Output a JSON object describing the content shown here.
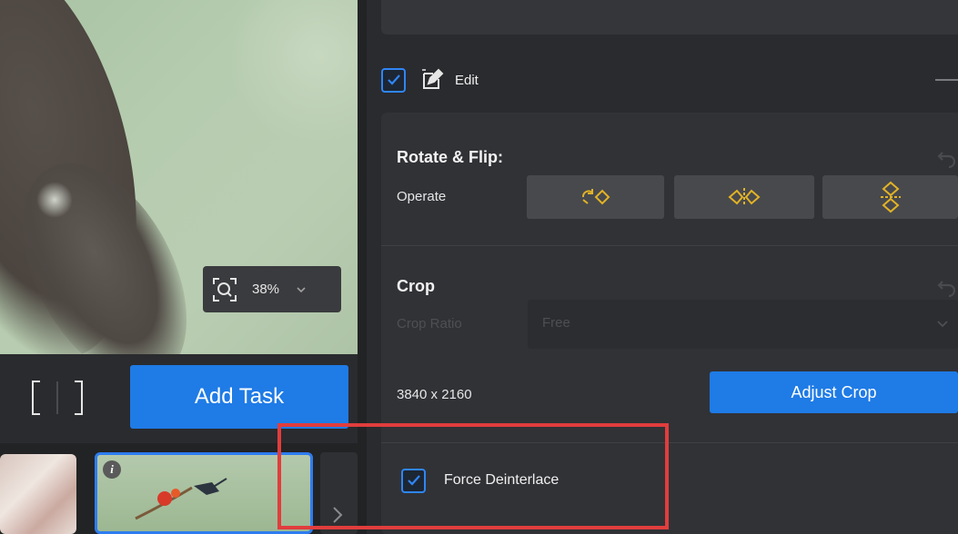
{
  "preview": {
    "zoom_value": "38%"
  },
  "bottom_bar": {
    "add_task_label": "Add Task"
  },
  "edit": {
    "label": "Edit",
    "checked": true
  },
  "rotate_flip": {
    "title": "Rotate & Flip:",
    "operate_label": "Operate",
    "buttons": [
      "rotate-icon",
      "flip-horizontal-icon",
      "flip-vertical-icon"
    ]
  },
  "crop": {
    "title": "Crop",
    "ratio_label": "Crop Ratio",
    "ratio_value": "Free",
    "resolution": "3840 x 2160",
    "adjust_label": "Adjust Crop"
  },
  "deinterlace": {
    "label": "Force Deinterlace",
    "checked": true
  },
  "colors": {
    "accent": "#1f7be6",
    "panel": "#313236",
    "highlight": "#e13d3d",
    "icon_gold": "#e2b325"
  }
}
